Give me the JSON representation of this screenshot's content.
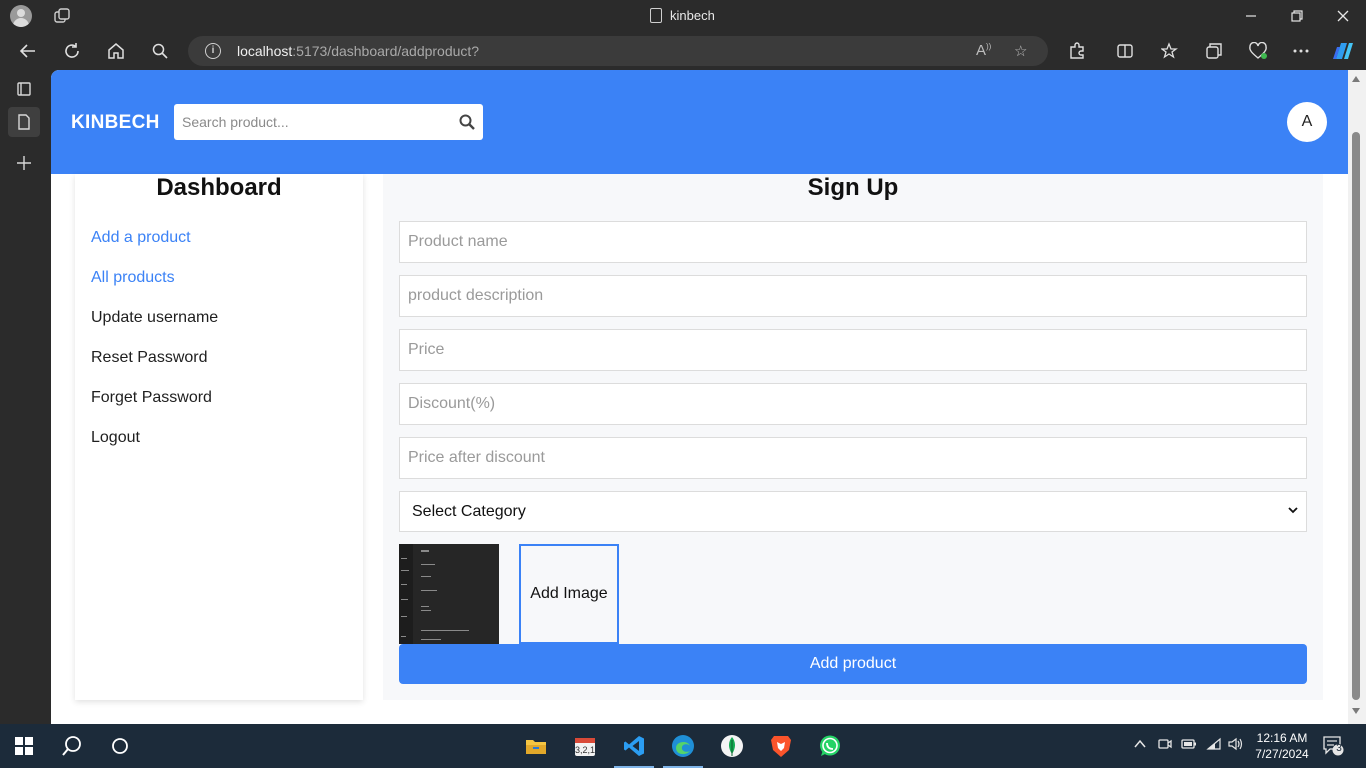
{
  "browser": {
    "tab_title": "kinbech",
    "url_host": "localhost",
    "url_path": ":5173/dashboard/addproduct?"
  },
  "header": {
    "brand": "KINBECH",
    "search_placeholder": "Search product...",
    "avatar_letter": "A"
  },
  "sidebar": {
    "title": "Dashboard",
    "items": [
      {
        "label": "Add a product"
      },
      {
        "label": "All products"
      },
      {
        "label": "Update username"
      },
      {
        "label": "Reset Password"
      },
      {
        "label": "Forget Password"
      },
      {
        "label": "Logout"
      }
    ]
  },
  "form": {
    "title": "Sign Up",
    "product_name_placeholder": "Product name",
    "description_placeholder": "product description",
    "price_placeholder": "Price",
    "discount_placeholder": "Discount(%)",
    "price_after_discount_placeholder": "Price after discount",
    "category_selected": "Select Category",
    "add_image_label": "Add Image",
    "submit_label": "Add product"
  },
  "taskbar": {
    "time": "12:16 AM",
    "date": "7/27/2024",
    "notification_count": "3"
  },
  "colors": {
    "primary": "#3b82f6",
    "link": "#3b82f6"
  }
}
